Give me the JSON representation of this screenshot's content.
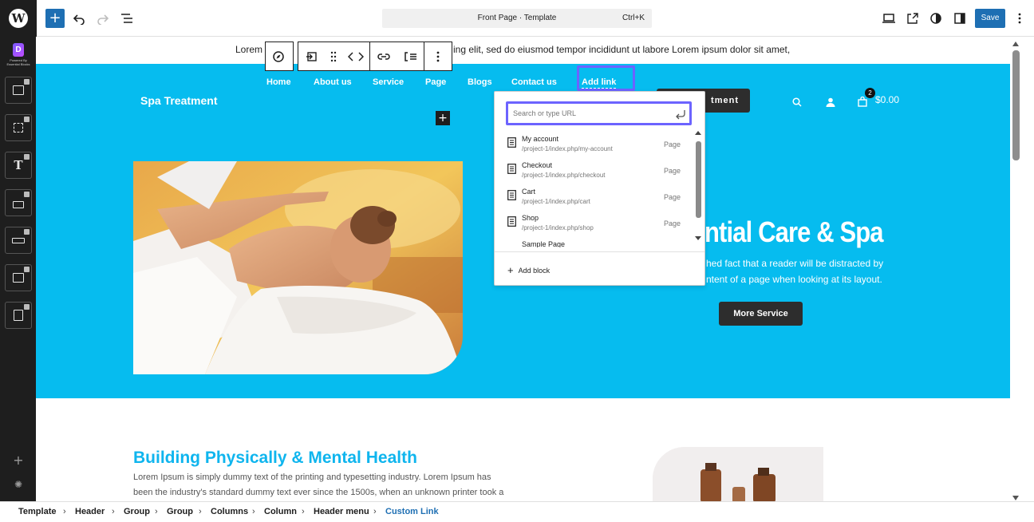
{
  "toolbar": {
    "wp_logo": "W",
    "add_icon": "+",
    "document_title": "Front Page · Template",
    "shortcut": "Ctrl+K",
    "save_label": "Save"
  },
  "sidebar": {
    "logo_letter": "D",
    "logo_text": "Powered By Essential Blocks",
    "bottom_add": "+"
  },
  "canvas": {
    "topline_left": "Lorem",
    "topline_right": "ing elit, sed do eiusmod tempor incididunt ut labore Lorem ipsum dolor sit amet,",
    "site_title": "Spa Treatment",
    "nav": [
      "Home",
      "About us",
      "Service",
      "Page",
      "Blogs",
      "Contact us"
    ],
    "add_link": "Add link",
    "appointment_partial": "tment",
    "cart_count": "2",
    "cart_total": "$0.00",
    "heading_partial": "ntial Care & Spa",
    "hero_text_1": "hed fact that a reader will be distracted by",
    "hero_text_2": "ntent of a page when looking at its layout.",
    "more_button": "More Service",
    "section2_title": "Building Physically & Mental Health",
    "section2_p1": "Lorem Ipsum is simply dummy text of the printing and typesetting industry. Lorem Ipsum has",
    "section2_p2": "been the industry's standard dummy text ever since the 1500s, when an unknown printer took a"
  },
  "link_popover": {
    "placeholder": "Search or type URL",
    "suggestions": [
      {
        "title": "My account",
        "url": "/project-1/index.php/my-account",
        "type": "Page"
      },
      {
        "title": "Checkout",
        "url": "/project-1/index.php/checkout",
        "type": "Page"
      },
      {
        "title": "Cart",
        "url": "/project-1/index.php/cart",
        "type": "Page"
      },
      {
        "title": "Shop",
        "url": "/project-1/index.php/shop",
        "type": "Page"
      },
      {
        "title": "Sample Page",
        "url": "",
        "type": ""
      }
    ],
    "add_block": "Add block"
  },
  "breadcrumb": [
    "Template",
    "Header",
    "Group",
    "Group",
    "Columns",
    "Column",
    "Header menu",
    "Custom Link"
  ],
  "colors": {
    "accent": "#1e6fb3",
    "hero_bg": "#06bcef",
    "highlight": "#6c63ff",
    "dark": "#1e1e1e"
  }
}
